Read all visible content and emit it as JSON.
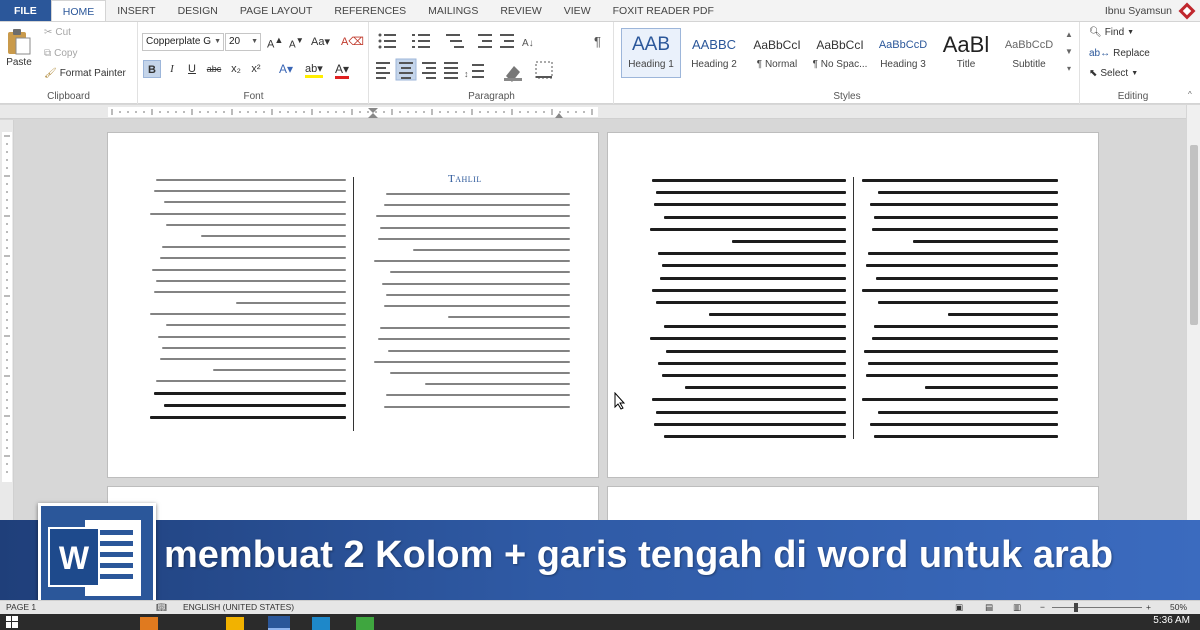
{
  "tabs": [
    "FILE",
    "HOME",
    "INSERT",
    "DESIGN",
    "PAGE LAYOUT",
    "REFERENCES",
    "MAILINGS",
    "REVIEW",
    "VIEW",
    "FOXIT READER PDF"
  ],
  "active_tab": "HOME",
  "user_name": "Ibnu Syamsun",
  "clipboard": {
    "paste": "Paste",
    "cut": "Cut",
    "copy": "Copy",
    "format_painter": "Format Painter",
    "label": "Clipboard"
  },
  "font": {
    "family": "Copperplate G",
    "size": "20",
    "label": "Font",
    "buttons": [
      "B",
      "I",
      "U",
      "abc",
      "x₂",
      "x²"
    ]
  },
  "paragraph": {
    "label": "Paragraph"
  },
  "styles": {
    "label": "Styles",
    "items": [
      {
        "preview": "AAB",
        "name": "Heading 1",
        "selected": true
      },
      {
        "preview": "AABBC",
        "name": "Heading 2",
        "selected": false
      },
      {
        "preview": "AaBbCcI",
        "name": "¶ Normal",
        "selected": false
      },
      {
        "preview": "AaBbCcI",
        "name": "¶ No Spac...",
        "selected": false
      },
      {
        "preview": "AaBbCcD",
        "name": "Heading 3",
        "selected": false
      },
      {
        "preview": "AaBl",
        "name": "Title",
        "selected": false
      },
      {
        "preview": "AaBbCcD",
        "name": "Subtitle",
        "selected": false
      }
    ]
  },
  "editing": {
    "find": "Find",
    "replace": "Replace",
    "select": "Select",
    "label": "Editing"
  },
  "document": {
    "page1_title": "Tahlil"
  },
  "banner": {
    "headline": "membuat 2 Kolom + garis tengah di word untuk arab"
  },
  "status": {
    "page": "PAGE 1",
    "language": "ENGLISH (UNITED STATES)",
    "zoom": "50%"
  },
  "taskbar": {
    "time": "5:36 AM"
  },
  "colors": {
    "word_blue": "#2b579a",
    "banner_blue": "#2f5aa5",
    "ribbon_bg": "#ffffff",
    "canvas_gray": "#d7d7d7"
  }
}
